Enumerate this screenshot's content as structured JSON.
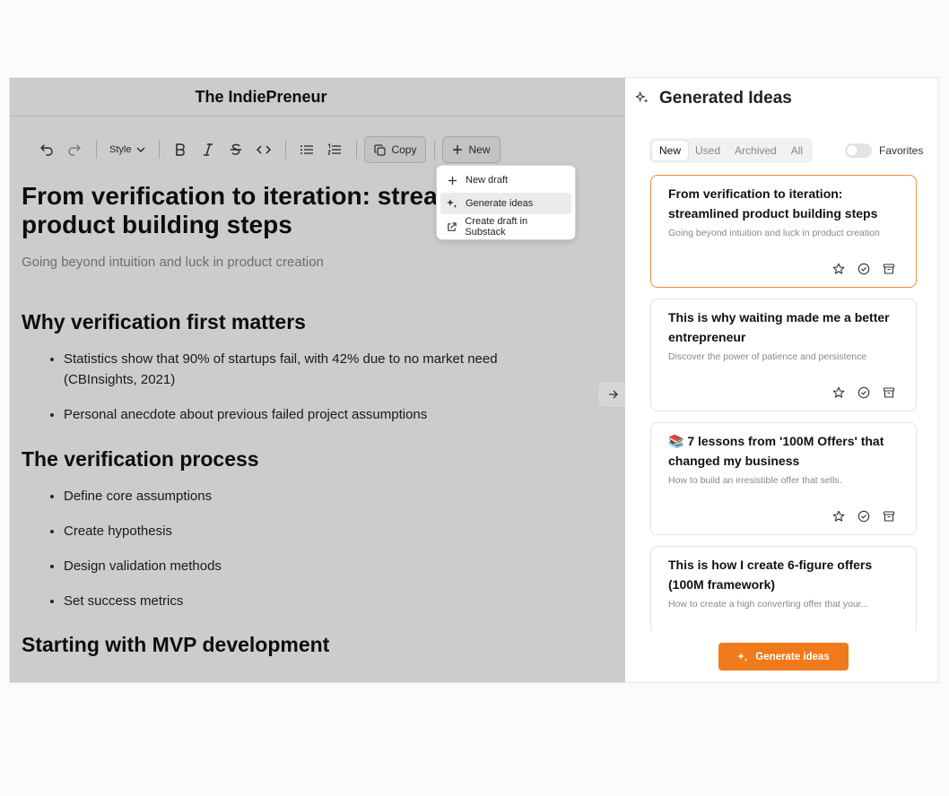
{
  "editor": {
    "doc_title": "The IndiePreneur",
    "toolbar": {
      "style_label": "Style",
      "copy_label": "Copy",
      "new_label": "New"
    },
    "menu": {
      "items": [
        {
          "label": "New draft",
          "icon": "plus-icon"
        },
        {
          "label": "Generate ideas",
          "icon": "sparkle-icon"
        },
        {
          "label": "Create draft in Substack",
          "icon": "external-link-icon"
        }
      ],
      "active_index": 1
    },
    "document": {
      "title": "From verification to iteration: streamlined product building steps",
      "subtitle": "Going beyond intuition and luck in product creation",
      "sections": [
        {
          "heading": "Why verification first matters",
          "bullets": [
            "Statistics show that 90% of startups fail, with 42% due to no market need (CBInsights, 2021)",
            "Personal anecdote about previous failed project assumptions"
          ]
        },
        {
          "heading": "The verification process",
          "bullets": [
            "Define core assumptions",
            "Create hypothesis",
            "Design validation methods",
            "Set success metrics"
          ]
        },
        {
          "heading": "Starting with MVP development",
          "bullets": []
        }
      ]
    }
  },
  "panel": {
    "title": "Generated Ideas",
    "tabs": [
      "New",
      "Used",
      "Archived",
      "All"
    ],
    "active_tab": "New",
    "favorites_label": "Favorites",
    "favorites_on": false,
    "ideas": [
      {
        "title": "From verification to iteration: streamlined product building steps",
        "subtitle": "Going beyond intuition and luck in product creation",
        "selected": true
      },
      {
        "title": "This is why waiting made me a better entrepreneur",
        "subtitle": "Discover the power of patience and persistence",
        "selected": false
      },
      {
        "title": "📚 7 lessons from '100M Offers' that changed my business",
        "subtitle": "How to build an irresistible offer that sells.",
        "selected": false
      },
      {
        "title": "This is how I create 6-figure offers (100M framework)",
        "subtitle": "How to create a high converting offer that your...",
        "selected": false
      }
    ],
    "generate_label": "Generate ideas"
  },
  "colors": {
    "accent": "#f07a1a",
    "selected_border": "#f08a3c",
    "overlay": "rgba(0,0,0,0.20)"
  }
}
